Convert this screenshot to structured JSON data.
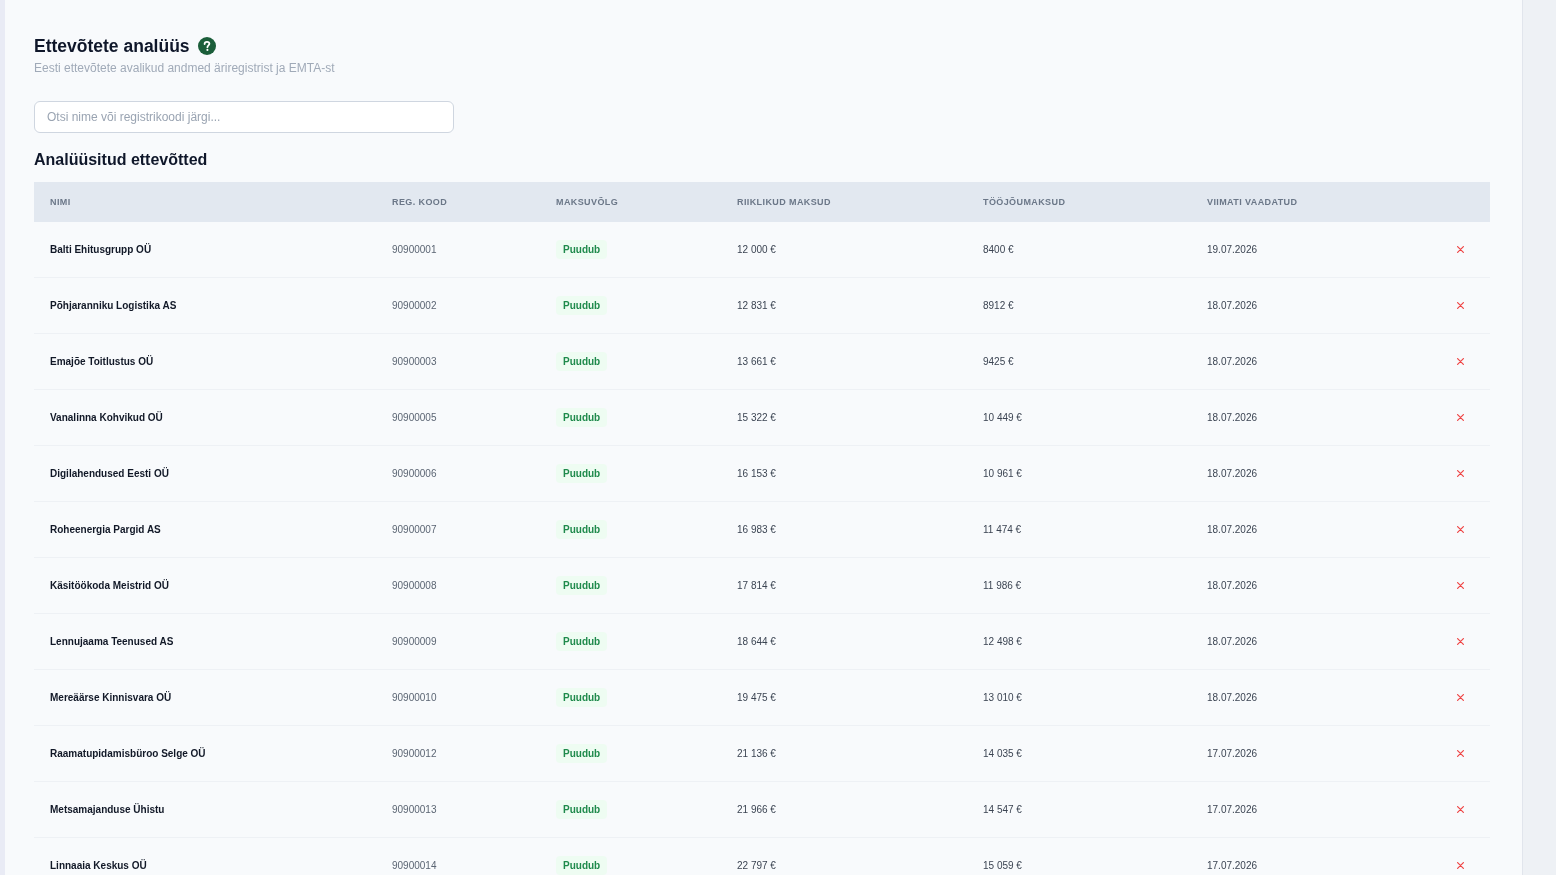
{
  "header": {
    "title": "Ettevõtete analüüs",
    "subtitle": "Eesti ettevõtete avalikud andmed äriregistrist ja EMTA-st"
  },
  "search": {
    "placeholder": "Otsi nime või registrikoodi järgi..."
  },
  "section_title": "Analüüsitud ettevõtted",
  "table": {
    "columns": [
      "NIMI",
      "REG. KOOD",
      "MAKSUVÕLG",
      "RIIKLIKUD MAKSUD",
      "TÖÖJÕUMAKSUD",
      "VIIMATI VAADATUD"
    ],
    "rows": [
      {
        "name": "Balti Ehitusgrupp OÜ",
        "reg_code": "90900001",
        "tax_debt": "Puudub",
        "state_taxes": "12 000 €",
        "labor_taxes": "8400 €",
        "last_viewed": "19.07.2026"
      },
      {
        "name": "Põhjaranniku Logistika AS",
        "reg_code": "90900002",
        "tax_debt": "Puudub",
        "state_taxes": "12 831 €",
        "labor_taxes": "8912 €",
        "last_viewed": "18.07.2026"
      },
      {
        "name": "Emajõe Toitlustus OÜ",
        "reg_code": "90900003",
        "tax_debt": "Puudub",
        "state_taxes": "13 661 €",
        "labor_taxes": "9425 €",
        "last_viewed": "18.07.2026"
      },
      {
        "name": "Vanalinna Kohvikud OÜ",
        "reg_code": "90900005",
        "tax_debt": "Puudub",
        "state_taxes": "15 322 €",
        "labor_taxes": "10 449 €",
        "last_viewed": "18.07.2026"
      },
      {
        "name": "Digilahendused Eesti OÜ",
        "reg_code": "90900006",
        "tax_debt": "Puudub",
        "state_taxes": "16 153 €",
        "labor_taxes": "10 961 €",
        "last_viewed": "18.07.2026"
      },
      {
        "name": "Roheenergia Pargid AS",
        "reg_code": "90900007",
        "tax_debt": "Puudub",
        "state_taxes": "16 983 €",
        "labor_taxes": "11 474 €",
        "last_viewed": "18.07.2026"
      },
      {
        "name": "Käsitöökoda Meistrid OÜ",
        "reg_code": "90900008",
        "tax_debt": "Puudub",
        "state_taxes": "17 814 €",
        "labor_taxes": "11 986 €",
        "last_viewed": "18.07.2026"
      },
      {
        "name": "Lennujaama Teenused AS",
        "reg_code": "90900009",
        "tax_debt": "Puudub",
        "state_taxes": "18 644 €",
        "labor_taxes": "12 498 €",
        "last_viewed": "18.07.2026"
      },
      {
        "name": "Mereäärse Kinnisvara OÜ",
        "reg_code": "90900010",
        "tax_debt": "Puudub",
        "state_taxes": "19 475 €",
        "labor_taxes": "13 010 €",
        "last_viewed": "18.07.2026"
      },
      {
        "name": "Raamatupidamisbüroo Selge OÜ",
        "reg_code": "90900012",
        "tax_debt": "Puudub",
        "state_taxes": "21 136 €",
        "labor_taxes": "14 035 €",
        "last_viewed": "17.07.2026"
      },
      {
        "name": "Metsamajanduse Ühistu",
        "reg_code": "90900013",
        "tax_debt": "Puudub",
        "state_taxes": "21 966 €",
        "labor_taxes": "14 547 €",
        "last_viewed": "17.07.2026"
      },
      {
        "name": "Linnaaia Keskus OÜ",
        "reg_code": "90900014",
        "tax_debt": "Puudub",
        "state_taxes": "22 797 €",
        "labor_taxes": "15 059 €",
        "last_viewed": "17.07.2026"
      }
    ]
  }
}
